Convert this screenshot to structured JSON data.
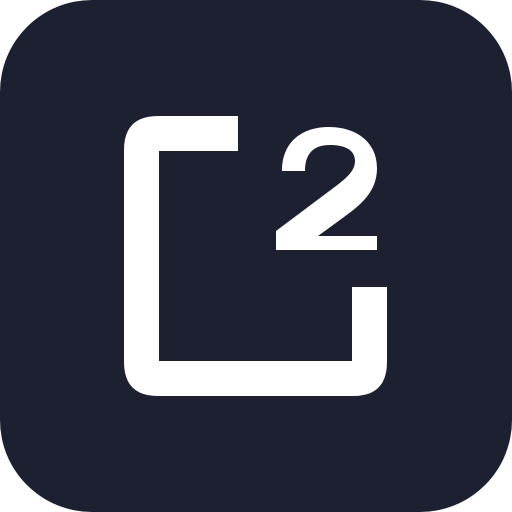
{
  "icon": {
    "name": "c-squared-logo",
    "background_color": "#1c2030",
    "foreground_color": "#ffffff",
    "glyph": "2"
  }
}
